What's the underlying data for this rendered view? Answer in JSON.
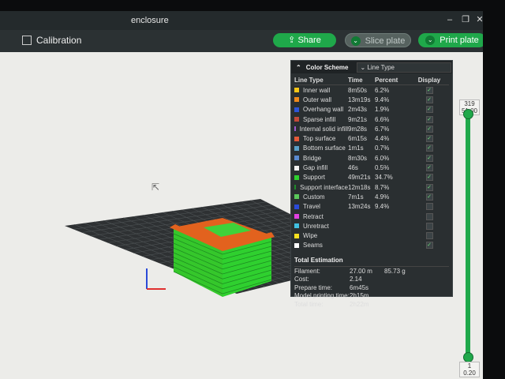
{
  "window": {
    "title": "enclosure"
  },
  "toolbar": {
    "calibration_label": "Calibration",
    "share_label": "Share",
    "slice_label": "Slice plate",
    "print_label": "Print plate"
  },
  "legend": {
    "scheme_label": "Color Scheme",
    "scheme_value": "Line Type",
    "headers": {
      "type": "Line Type",
      "time": "Time",
      "percent": "Percent",
      "display": "Display"
    },
    "rows": [
      {
        "name": "Inner wall",
        "time": "8m50s",
        "percent": "6.2%",
        "color": "#f5c518",
        "display": true
      },
      {
        "name": "Outer wall",
        "time": "13m19s",
        "percent": "9.4%",
        "color": "#f08a1c",
        "display": true
      },
      {
        "name": "Overhang wall",
        "time": "2m43s",
        "percent": "1.9%",
        "color": "#2e55d8",
        "display": true
      },
      {
        "name": "Sparse infill",
        "time": "9m21s",
        "percent": "6.6%",
        "color": "#c44a3a",
        "display": true
      },
      {
        "name": "Internal solid infill",
        "time": "9m28s",
        "percent": "6.7%",
        "color": "#a05ad0",
        "display": true
      },
      {
        "name": "Top surface",
        "time": "6m15s",
        "percent": "4.4%",
        "color": "#e55a3a",
        "display": true
      },
      {
        "name": "Bottom surface",
        "time": "1m1s",
        "percent": "0.7%",
        "color": "#5aa0c8",
        "display": true
      },
      {
        "name": "Bridge",
        "time": "8m30s",
        "percent": "6.0%",
        "color": "#5a8ad0",
        "display": true
      },
      {
        "name": "Gap infill",
        "time": "46s",
        "percent": "0.5%",
        "color": "#f2f2f2",
        "display": true
      },
      {
        "name": "Support",
        "time": "49m21s",
        "percent": "34.7%",
        "color": "#2fd02f",
        "display": true
      },
      {
        "name": "Support interface",
        "time": "12m18s",
        "percent": "8.7%",
        "color": "#1f8a2a",
        "display": true
      },
      {
        "name": "Custom",
        "time": "7m1s",
        "percent": "4.9%",
        "color": "#5ac85a",
        "display": true
      },
      {
        "name": "Travel",
        "time": "13m24s",
        "percent": "9.4%",
        "color": "#2a4ad8",
        "display": false
      },
      {
        "name": "Retract",
        "time": "",
        "percent": "",
        "color": "#e040e0",
        "display": false
      },
      {
        "name": "Unretract",
        "time": "",
        "percent": "",
        "color": "#40c0e0",
        "display": false
      },
      {
        "name": "Wipe",
        "time": "",
        "percent": "",
        "color": "#f5e020",
        "display": false
      },
      {
        "name": "Seams",
        "time": "",
        "percent": "",
        "color": "#ffffff",
        "display": true
      }
    ]
  },
  "estimation": {
    "title": "Total Estimation",
    "rows": [
      {
        "label": "Filament:",
        "v1": "27.00 m",
        "v2": "85.73 g"
      },
      {
        "label": "Cost:",
        "v1": "2.14",
        "v2": ""
      },
      {
        "label": "Prepare time:",
        "v1": "6m45s",
        "v2": ""
      },
      {
        "label": "Model printing time:",
        "v1": "2h15m",
        "v2": ""
      },
      {
        "label": "Total time:",
        "v1": "2h22m",
        "v2": ""
      }
    ]
  },
  "layer_slider": {
    "top_layer": "319",
    "top_height": "51.00",
    "bottom_layer": "1",
    "bottom_height": "0.20"
  }
}
